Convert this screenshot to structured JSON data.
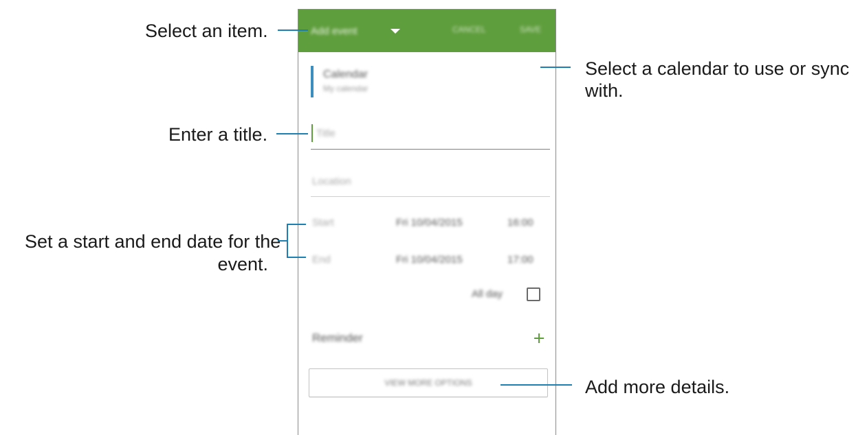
{
  "screen": {
    "appbar": {
      "item_select_label": "Add event",
      "cancel_label": "CANCEL",
      "save_label": "SAVE",
      "color": "#5f9e3d"
    },
    "calendar": {
      "label": "Calendar",
      "value": "My calendar",
      "accent": "#3c8dc0"
    },
    "title_field": {
      "placeholder": "Title",
      "accent": "#5f9e3d"
    },
    "location_field": {
      "placeholder": "Location"
    },
    "start": {
      "label": "Start",
      "date": "Fri 10/04/2015",
      "time": "16:00"
    },
    "end": {
      "label": "End",
      "date": "Fri 10/04/2015",
      "time": "17:00"
    },
    "all_day": {
      "label": "All day",
      "checked": false
    },
    "reminder": {
      "label": "Reminder",
      "add_icon": "plus-icon"
    },
    "view_more_label": "VIEW MORE OPTIONS"
  },
  "callouts": {
    "select_item": "Select an item.",
    "select_calendar_line1": "Select a calendar to use or sync",
    "select_calendar_line2": "with.",
    "enter_title": "Enter a title.",
    "set_dates_line1": "Set a start and end date for the",
    "set_dates_line2": "event.",
    "add_details": "Add more details."
  },
  "colors": {
    "callout_line": "#1b7fb3"
  }
}
